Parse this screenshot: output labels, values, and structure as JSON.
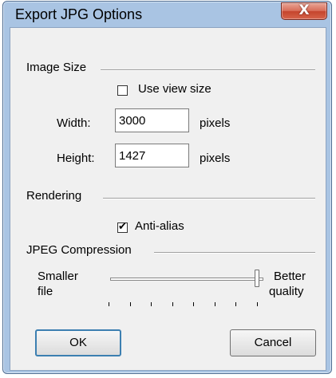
{
  "window": {
    "title": "Export JPG Options",
    "close_label": "X"
  },
  "image_size": {
    "section_label": "Image Size",
    "use_view_size": {
      "label": "Use view size",
      "checked": false
    },
    "width": {
      "label": "Width:",
      "value": "3000",
      "unit": "pixels"
    },
    "height": {
      "label": "Height:",
      "value": "1427",
      "unit": "pixels"
    }
  },
  "rendering": {
    "section_label": "Rendering",
    "anti_alias": {
      "label": "Anti-alias",
      "checked": true,
      "check_glyph": "✔"
    }
  },
  "jpeg_compression": {
    "section_label": "JPEG Compression",
    "left_label_line1": "Smaller",
    "left_label_line2": "file",
    "right_label_line1": "Better",
    "right_label_line2": "quality",
    "quality_level": 1.0,
    "tick_count": 8
  },
  "buttons": {
    "ok_label": "OK",
    "cancel_label": "Cancel"
  },
  "colors": {
    "frame": "#a9c4e3",
    "close_button": "#c5452d",
    "client_bg": "#f0f0f0"
  }
}
